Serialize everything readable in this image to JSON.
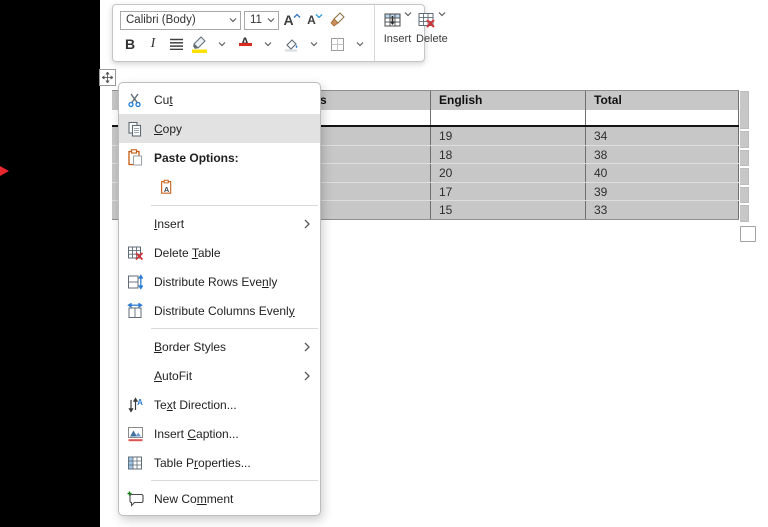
{
  "toolbar": {
    "font_name": "Calibri (Body)",
    "font_size": "11",
    "insert_label": "Insert",
    "delete_label": "Delete"
  },
  "menu": {
    "cut": {
      "pre": "Cu",
      "accel": "t",
      "post": ""
    },
    "copy": {
      "pre": "",
      "accel": "C",
      "post": "opy"
    },
    "paste_options": {
      "label": "Paste Options:"
    },
    "insert": {
      "pre": "",
      "accel": "I",
      "post": "nsert"
    },
    "delete_table": {
      "pre": "Delete ",
      "accel": "T",
      "post": "able"
    },
    "distribute_rows": {
      "pre": "Distribute Rows Eve",
      "accel": "n",
      "post": "ly"
    },
    "distribute_columns": {
      "pre": "Distribute Columns Evenl",
      "accel": "y",
      "post": ""
    },
    "border_styles": {
      "pre": "",
      "accel": "B",
      "post": "order Styles"
    },
    "autofit": {
      "pre": "",
      "accel": "A",
      "post": "utoFit"
    },
    "text_direction": {
      "pre": "Te",
      "accel": "x",
      "post": "t Direction..."
    },
    "insert_caption": {
      "pre": "Insert ",
      "accel": "C",
      "post": "aption..."
    },
    "table_properties": {
      "pre": "Table P",
      "accel": "r",
      "post": "operties..."
    },
    "new_comment": {
      "pre": "New Co",
      "accel": "m",
      "post": "ment"
    }
  },
  "table": {
    "headers": {
      "col1_fragment": "s",
      "col2": "English",
      "col3": "Total"
    },
    "rows": [
      {
        "english": "19",
        "total": "34"
      },
      {
        "english": "18",
        "total": "38"
      },
      {
        "english": "20",
        "total": "40"
      },
      {
        "english": "17",
        "total": "39"
      },
      {
        "english": "15",
        "total": "33"
      }
    ]
  },
  "icons": {
    "toolbar": [
      "grow-font",
      "shrink-font",
      "format-painter",
      "insert-table",
      "delete-table",
      "bold",
      "italic",
      "justify-lines",
      "text-highlight-yellow",
      "font-color-red",
      "shading-bucket",
      "borders-grid",
      "chevron-down"
    ],
    "menu": [
      "scissors",
      "copy-pages",
      "clipboard",
      "clipboard-keep-text",
      "table-delete-x",
      "distribute-rows-arrows",
      "distribute-columns-arrows",
      "text-direction-arrows",
      "picture-caption",
      "table-properties-grid",
      "comment-bubble-plus",
      "submenu-chevron"
    ],
    "table": [
      "move-handle-cross",
      "resize-handle-square"
    ]
  },
  "colors": {
    "selection_gray": "#c7c7c7",
    "menu_highlight": "#e2e2e2",
    "accent_blue": "#2b7cd3",
    "accent_orange": "#c55a11",
    "accent_red": "#d13438",
    "highlight_yellow": "#ffe100",
    "font_color_red": "#d92b1f",
    "annotation_red": "#e8262d",
    "letterbox_black": "#000000"
  }
}
